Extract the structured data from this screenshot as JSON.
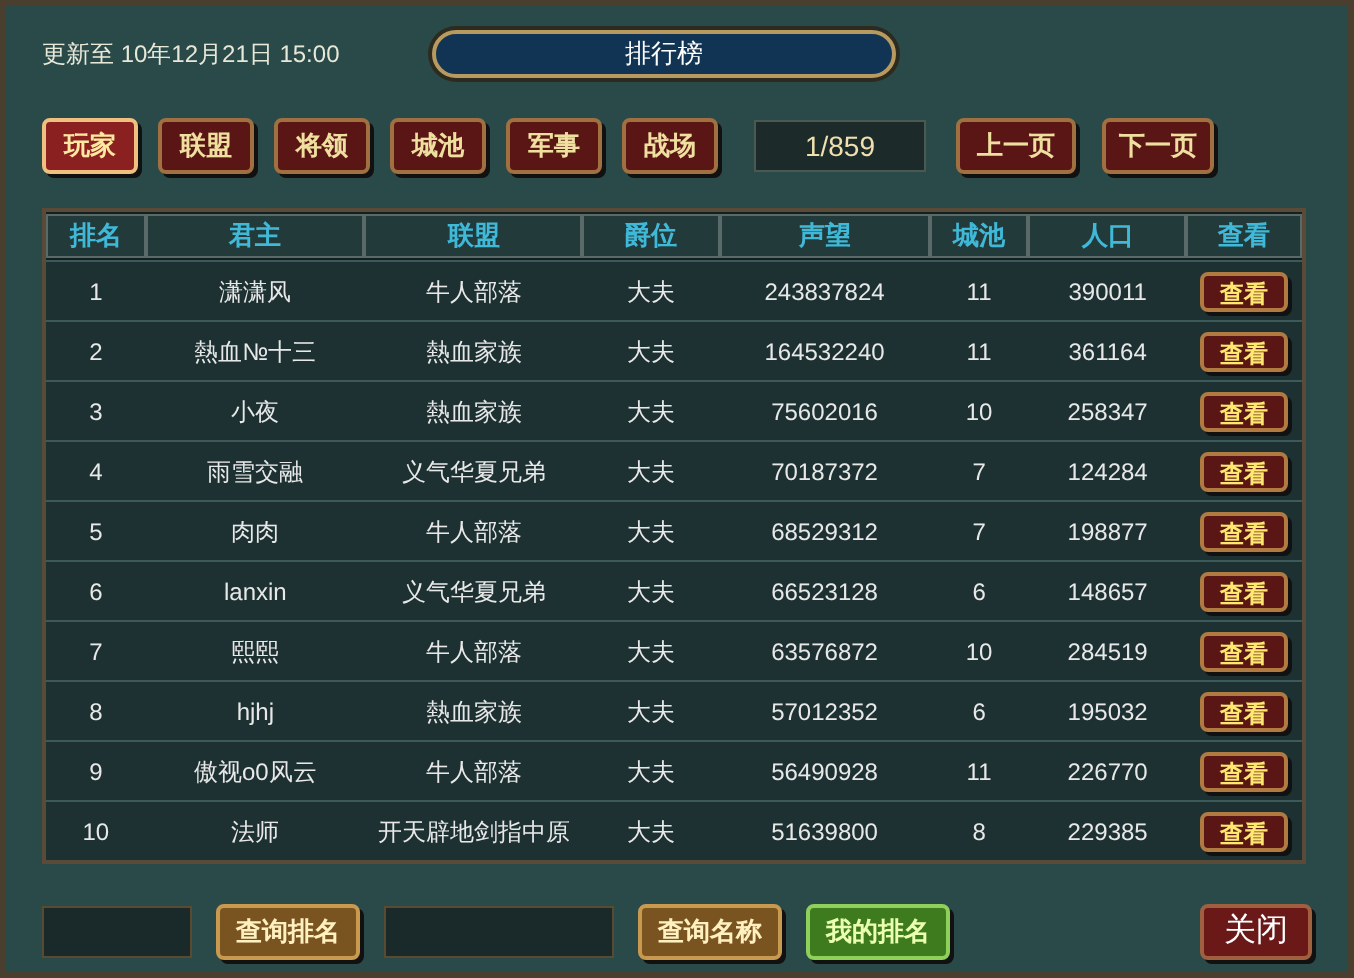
{
  "updated": "更新至 10年12月21日 15:00",
  "title": "排行榜",
  "tabs": [
    {
      "label": "玩家",
      "selected": true
    },
    {
      "label": "联盟",
      "selected": false
    },
    {
      "label": "将领",
      "selected": false
    },
    {
      "label": "城池",
      "selected": false
    },
    {
      "label": "军事",
      "selected": false
    },
    {
      "label": "战场",
      "selected": false
    }
  ],
  "page": "1/859",
  "prev": "上一页",
  "next": "下一页",
  "table": {
    "columns": [
      "排名",
      "君主",
      "联盟",
      "爵位",
      "声望",
      "城池",
      "人口",
      "查看"
    ],
    "rows": [
      {
        "cells": [
          "1",
          "潇潇风",
          "牛人部落",
          "大夫",
          "243837824",
          "11",
          "390011"
        ],
        "action": "查看"
      },
      {
        "cells": [
          "2",
          "熱血№十三",
          "熱血家族",
          "大夫",
          "164532240",
          "11",
          "361164"
        ],
        "action": "查看"
      },
      {
        "cells": [
          "3",
          "小夜",
          "熱血家族",
          "大夫",
          "75602016",
          "10",
          "258347"
        ],
        "action": "查看"
      },
      {
        "cells": [
          "4",
          "雨雪交融",
          "义气华夏兄弟",
          "大夫",
          "70187372",
          "7",
          "124284"
        ],
        "action": "查看"
      },
      {
        "cells": [
          "5",
          "肉肉",
          "牛人部落",
          "大夫",
          "68529312",
          "7",
          "198877"
        ],
        "action": "查看"
      },
      {
        "cells": [
          "6",
          "lanxin",
          "义气华夏兄弟",
          "大夫",
          "66523128",
          "6",
          "148657"
        ],
        "action": "查看"
      },
      {
        "cells": [
          "7",
          "熙熙",
          "牛人部落",
          "大夫",
          "63576872",
          "10",
          "284519"
        ],
        "action": "查看"
      },
      {
        "cells": [
          "8",
          "hjhj",
          "熱血家族",
          "大夫",
          "57012352",
          "6",
          "195032"
        ],
        "action": "查看"
      },
      {
        "cells": [
          "9",
          "傲视o0风云",
          "牛人部落",
          "大夫",
          "56490928",
          "11",
          "226770"
        ],
        "action": "查看"
      },
      {
        "cells": [
          "10",
          "法师",
          "开天辟地剑指中原",
          "大夫",
          "51639800",
          "8",
          "229385"
        ],
        "action": "查看"
      }
    ]
  },
  "footer": [
    {
      "kind": "field"
    },
    {
      "kind": "gold",
      "label": "查询排名"
    },
    {
      "kind": "wide-field"
    },
    {
      "kind": "gold",
      "label": "查询名称"
    },
    {
      "kind": "green",
      "label": "我的排名"
    }
  ],
  "close": "关闭"
}
